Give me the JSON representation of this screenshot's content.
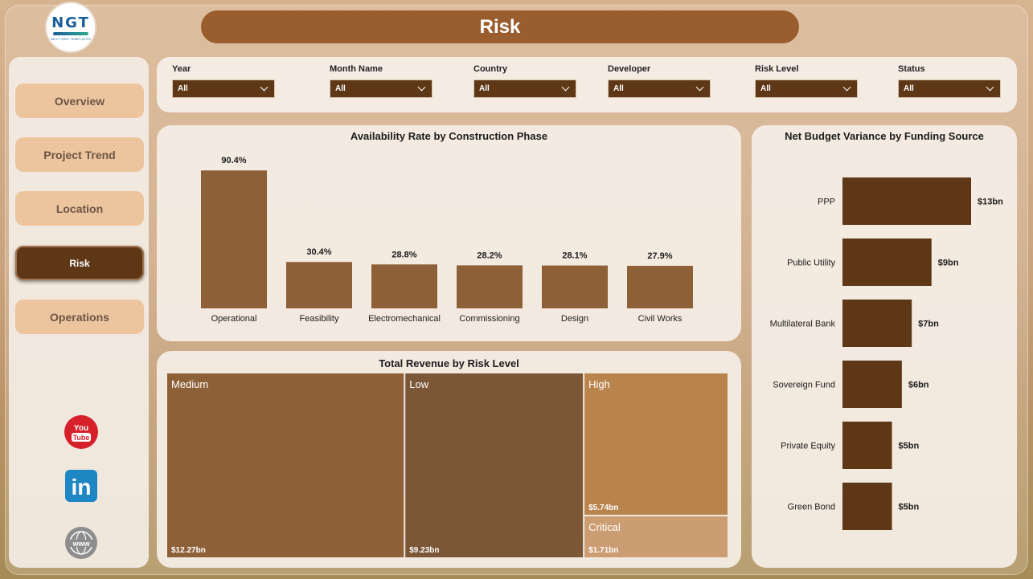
{
  "app": {
    "page_title": "Risk",
    "logo": {
      "text": "NGT",
      "subtitle": "NEXT GEN TEMPLATES"
    }
  },
  "nav": {
    "items": [
      {
        "label": "Overview",
        "active": false
      },
      {
        "label": "Project Trend",
        "active": false
      },
      {
        "label": "Location",
        "active": false
      },
      {
        "label": "Risk",
        "active": true
      },
      {
        "label": "Operations",
        "active": false
      }
    ]
  },
  "social": [
    {
      "icon": "youtube-icon",
      "label": "You Tube"
    },
    {
      "icon": "linkedin-icon",
      "label": "in"
    },
    {
      "icon": "globe-icon",
      "label": "www"
    }
  ],
  "filters": [
    {
      "label": "Year",
      "value": "All"
    },
    {
      "label": "Month Name",
      "value": "All"
    },
    {
      "label": "Country",
      "value": "All"
    },
    {
      "label": "Developer",
      "value": "All"
    },
    {
      "label": "Risk Level",
      "value": "All"
    },
    {
      "label": "Status",
      "value": "All"
    }
  ],
  "colors": {
    "title_bar": "#9a5e2e",
    "nav_button": "#ecc59f",
    "nav_active": "#5e3716",
    "bar_availability": "#8e6038",
    "bar_budget": "#5e3716"
  },
  "chart_data": [
    {
      "type": "bar",
      "title": "Availability Rate by Construction Phase",
      "categories": [
        "Operational",
        "Feasibility",
        "Electromechanical",
        "Commissioning",
        "Design",
        "Civil Works"
      ],
      "values": [
        90.4,
        30.4,
        28.8,
        28.2,
        28.1,
        27.9
      ],
      "labels": [
        "90.4%",
        "30.4%",
        "28.8%",
        "28.2%",
        "28.1%",
        "27.9%"
      ],
      "ylim": [
        0,
        100
      ],
      "unit": "%"
    },
    {
      "type": "bar",
      "orientation": "horizontal",
      "title": "Net Budget Variance by Funding Source",
      "categories": [
        "PPP",
        "Public Utility",
        "Multilateral Bank",
        "Sovereign Fund",
        "Private Equity",
        "Green Bond"
      ],
      "values": [
        13,
        9,
        7,
        6,
        5,
        5
      ],
      "labels": [
        "$13bn",
        "$9bn",
        "$7bn",
        "$6bn",
        "$5bn",
        "$5bn"
      ],
      "unit": "bn"
    },
    {
      "type": "treemap",
      "title": "Total Revenue by Risk Level",
      "categories": [
        "Medium",
        "Low",
        "High",
        "Critical"
      ],
      "values": [
        12.27,
        9.23,
        5.74,
        1.71
      ],
      "labels": [
        "$12.27bn",
        "$9.23bn",
        "$5.74bn",
        "$1.71bn"
      ],
      "colors": [
        "#8e6038",
        "#7b5738",
        "#b9834c",
        "#cc9d72"
      ],
      "unit": "bn"
    }
  ]
}
